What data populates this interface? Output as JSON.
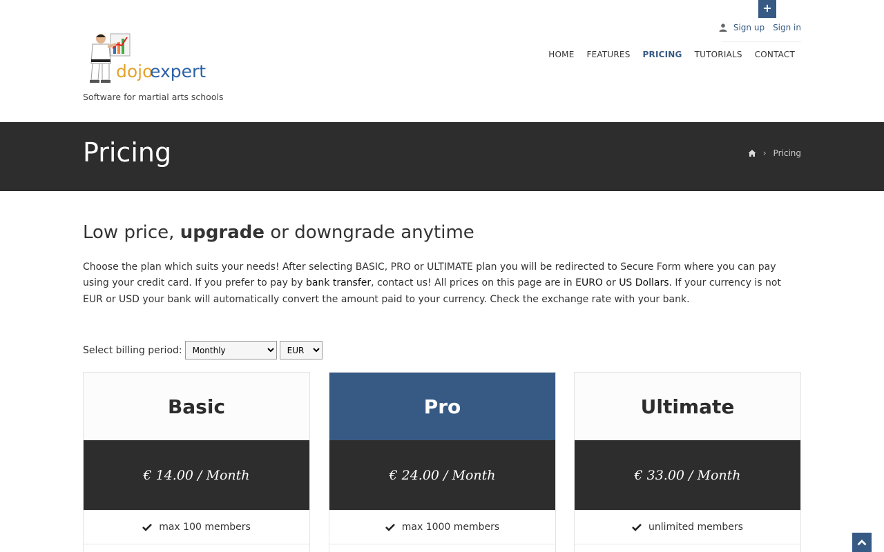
{
  "header": {
    "plus_label": "+",
    "signup_label": "Sign up",
    "signin_label": "Sign in",
    "logo_text_a": "dojo",
    "logo_text_b": "expert",
    "tagline": "Software for martial arts schools",
    "nav": [
      {
        "label": "HOME"
      },
      {
        "label": "FEATURES"
      },
      {
        "label": "PRICING"
      },
      {
        "label": "TUTORIALS"
      },
      {
        "label": "CONTACT"
      }
    ],
    "active_nav": "PRICING"
  },
  "banner": {
    "title": "Pricing",
    "breadcrumb_sep": "›",
    "breadcrumb_current": "Pricing"
  },
  "intro": {
    "title_a": "Low price, ",
    "title_b": "upgrade",
    "title_c": " or downgrade anytime",
    "p1": "Choose the plan which suits your needs! After selecting BASIC, PRO or ULTIMATE plan you will be redirected to Secure Form where you can pay using your credit card. If you prefer to pay by ",
    "p_bank": "bank transfer",
    "p2": ", contact us! All prices on this page are in ",
    "p_euro": "EURO",
    "p3": " or ",
    "p_usd": "US Dollars",
    "p4": ". If your currency is not EUR or USD your bank will automatically convert the amount paid to your currency. Check the exchange rate with your bank."
  },
  "billing": {
    "label": "Select billing period:",
    "period": "Monthly",
    "currency": "EUR"
  },
  "plans": [
    {
      "name": "Basic",
      "price": "€ 14.00 / Month",
      "feature": "max 100 members"
    },
    {
      "name": "Pro",
      "price": "€ 24.00 / Month",
      "feature": "max 1000 members"
    },
    {
      "name": "Ultimate",
      "price": "€ 33.00 / Month",
      "feature": "unlimited members"
    }
  ],
  "colors": {
    "accent": "#375a85",
    "dark": "#2d2d2d"
  }
}
